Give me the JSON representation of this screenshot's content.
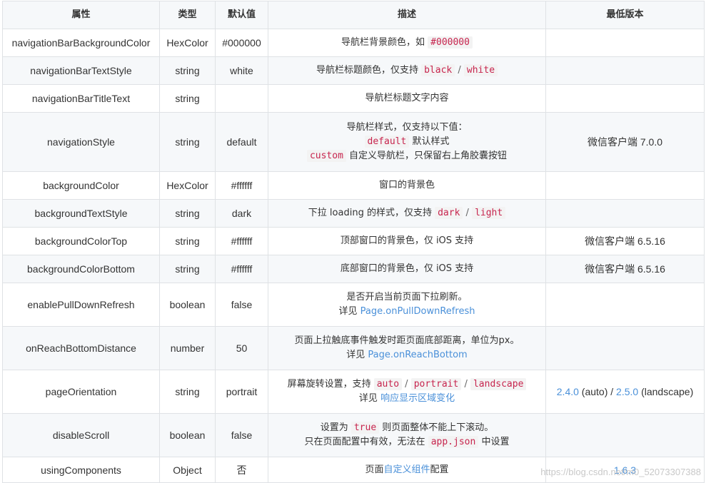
{
  "colors": {
    "header_bg": "#f6f8fa",
    "stripe_bg": "#f6f8fa",
    "border": "#dfe2e5",
    "code_text": "#c7254e",
    "code_bg": "#f3f3f3",
    "link": "#4a90d9",
    "text": "#333333"
  },
  "table": {
    "headers": [
      "属性",
      "类型",
      "默认值",
      "描述",
      "最低版本"
    ],
    "rows": [
      {
        "property": "navigationBarBackgroundColor",
        "type": "HexColor",
        "default": "#000000",
        "description_lines": [
          [
            {
              "kind": "text",
              "value": "导航栏背景颜色，如 "
            },
            {
              "kind": "code",
              "value": "#000000"
            }
          ]
        ],
        "version": []
      },
      {
        "property": "navigationBarTextStyle",
        "type": "string",
        "default": "white",
        "description_lines": [
          [
            {
              "kind": "text",
              "value": "导航栏标题颜色，仅支持 "
            },
            {
              "kind": "code",
              "value": "black"
            },
            {
              "kind": "sep",
              "value": " / "
            },
            {
              "kind": "code",
              "value": "white"
            }
          ]
        ],
        "version": []
      },
      {
        "property": "navigationBarTitleText",
        "type": "string",
        "default": "",
        "description_lines": [
          [
            {
              "kind": "text",
              "value": "导航栏标题文字内容"
            }
          ]
        ],
        "version": []
      },
      {
        "property": "navigationStyle",
        "type": "string",
        "default": "default",
        "description_lines": [
          [
            {
              "kind": "text",
              "value": "导航栏样式，仅支持以下值："
            }
          ],
          [
            {
              "kind": "code",
              "value": "default"
            },
            {
              "kind": "text",
              "value": " 默认样式"
            }
          ],
          [
            {
              "kind": "code",
              "value": "custom"
            },
            {
              "kind": "text",
              "value": " 自定义导航栏，只保留右上角胶囊按钮"
            }
          ]
        ],
        "version": [
          {
            "kind": "text",
            "value": "微信客户端 7.0.0"
          }
        ]
      },
      {
        "property": "backgroundColor",
        "type": "HexColor",
        "default": "#ffffff",
        "description_lines": [
          [
            {
              "kind": "text",
              "value": "窗口的背景色"
            }
          ]
        ],
        "version": []
      },
      {
        "property": "backgroundTextStyle",
        "type": "string",
        "default": "dark",
        "description_lines": [
          [
            {
              "kind": "text",
              "value": "下拉 loading 的样式，仅支持 "
            },
            {
              "kind": "code",
              "value": "dark"
            },
            {
              "kind": "sep",
              "value": " / "
            },
            {
              "kind": "code",
              "value": "light"
            }
          ]
        ],
        "version": []
      },
      {
        "property": "backgroundColorTop",
        "type": "string",
        "default": "#ffffff",
        "description_lines": [
          [
            {
              "kind": "text",
              "value": "顶部窗口的背景色，仅 iOS 支持"
            }
          ]
        ],
        "version": [
          {
            "kind": "text",
            "value": "微信客户端 6.5.16"
          }
        ]
      },
      {
        "property": "backgroundColorBottom",
        "type": "string",
        "default": "#ffffff",
        "description_lines": [
          [
            {
              "kind": "text",
              "value": "底部窗口的背景色，仅 iOS 支持"
            }
          ]
        ],
        "version": [
          {
            "kind": "text",
            "value": "微信客户端 6.5.16"
          }
        ]
      },
      {
        "property": "enablePullDownRefresh",
        "type": "boolean",
        "default": "false",
        "description_lines": [
          [
            {
              "kind": "text",
              "value": "是否开启当前页面下拉刷新。"
            }
          ],
          [
            {
              "kind": "text",
              "value": "详见 "
            },
            {
              "kind": "link",
              "value": "Page.onPullDownRefresh"
            }
          ]
        ],
        "version": []
      },
      {
        "property": "onReachBottomDistance",
        "type": "number",
        "default": "50",
        "description_lines": [
          [
            {
              "kind": "text",
              "value": "页面上拉触底事件触发时距页面底部距离，单位为px。"
            }
          ],
          [
            {
              "kind": "text",
              "value": "详见 "
            },
            {
              "kind": "link",
              "value": "Page.onReachBottom"
            }
          ]
        ],
        "version": []
      },
      {
        "property": "pageOrientation",
        "type": "string",
        "default": "portrait",
        "description_lines": [
          [
            {
              "kind": "text",
              "value": "屏幕旋转设置，支持 "
            },
            {
              "kind": "code",
              "value": "auto"
            },
            {
              "kind": "sep",
              "value": " / "
            },
            {
              "kind": "code",
              "value": "portrait"
            },
            {
              "kind": "sep",
              "value": " / "
            },
            {
              "kind": "code",
              "value": "landscape"
            }
          ],
          [
            {
              "kind": "text",
              "value": "详见 "
            },
            {
              "kind": "link",
              "value": "响应显示区域变化"
            }
          ]
        ],
        "version": [
          {
            "kind": "link",
            "value": "2.4.0"
          },
          {
            "kind": "text",
            "value": " (auto) / "
          },
          {
            "kind": "link",
            "value": "2.5.0"
          },
          {
            "kind": "text",
            "value": " (landscape)"
          }
        ]
      },
      {
        "property": "disableScroll",
        "type": "boolean",
        "default": "false",
        "description_lines": [
          [
            {
              "kind": "text",
              "value": "设置为 "
            },
            {
              "kind": "code",
              "value": "true"
            },
            {
              "kind": "text",
              "value": " 则页面整体不能上下滚动。"
            }
          ],
          [
            {
              "kind": "text",
              "value": "只在页面配置中有效，无法在 "
            },
            {
              "kind": "code",
              "value": "app.json"
            },
            {
              "kind": "text",
              "value": " 中设置"
            }
          ]
        ],
        "version": []
      },
      {
        "property": "usingComponents",
        "type": "Object",
        "default": "否",
        "description_lines": [
          [
            {
              "kind": "text",
              "value": "页面"
            },
            {
              "kind": "link",
              "value": "自定义组件"
            },
            {
              "kind": "text",
              "value": "配置"
            }
          ]
        ],
        "version": [
          {
            "kind": "link",
            "value": "1.6.3"
          }
        ]
      }
    ]
  },
  "watermark": "https://blog.csdn.net/m0_52073307388"
}
